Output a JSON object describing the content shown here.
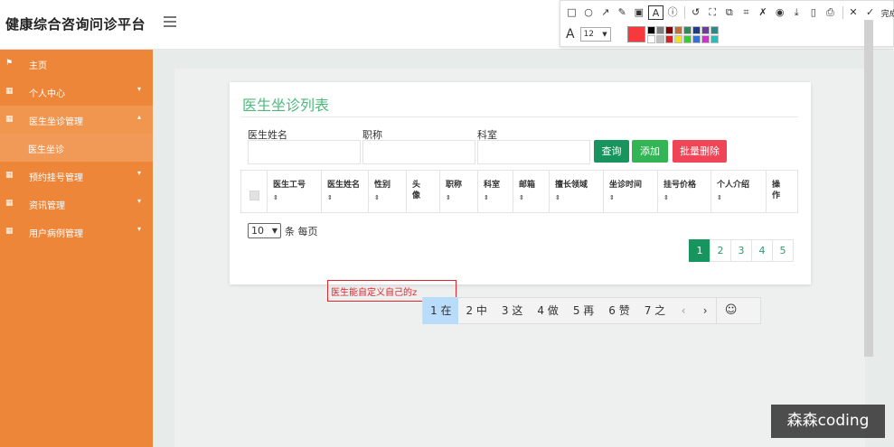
{
  "app": {
    "title": "健康综合咨询问诊平台"
  },
  "user": {
    "avatar_text": "头像"
  },
  "screenshot_tool": {
    "tools": [
      "□",
      "○",
      "↗",
      "✎",
      "▣",
      "A",
      "ⓘ",
      "↺",
      "⛶",
      "⧉",
      "⌗",
      "✗",
      "◉",
      "⤓",
      "▯",
      "⎙",
      "✕",
      "✓"
    ],
    "done_label": "完成",
    "font_size": "12",
    "current_color": "#f5393c",
    "palette": [
      "#000000",
      "#808080",
      "#800000",
      "#c07030",
      "#2e8b57",
      "#1e3a8a",
      "#6a3d9a",
      "#2a8a8a",
      "#ffffff",
      "#c0c0c0",
      "#e02020",
      "#f0e020",
      "#30d030",
      "#3070e0",
      "#d030d0",
      "#20c0c0"
    ]
  },
  "sidebar": {
    "items": [
      {
        "label": "主页",
        "icon": "flag-icon",
        "caret": ""
      },
      {
        "label": "个人中心",
        "icon": "grid-icon",
        "caret": "▾"
      },
      {
        "label": "医生坐诊管理",
        "icon": "grid-icon",
        "caret": "▴"
      },
      {
        "label": "医生坐诊",
        "icon": "",
        "caret": ""
      },
      {
        "label": "预约挂号管理",
        "icon": "grid-icon",
        "caret": "▾"
      },
      {
        "label": "资讯管理",
        "icon": "grid-icon",
        "caret": "▾"
      },
      {
        "label": "用户病例管理",
        "icon": "grid-icon",
        "caret": "▾"
      }
    ]
  },
  "page": {
    "title": "医生坐诊列表",
    "filters": {
      "doctor_name_label": "医生姓名",
      "title_label": "职称",
      "department_label": "科室"
    },
    "buttons": {
      "query": "查询",
      "add": "添加",
      "batch_delete": "批量删除"
    },
    "table": {
      "columns": [
        "医生工号",
        "医生姓名",
        "性别",
        "头像",
        "职称",
        "科室",
        "邮箱",
        "擅长领域",
        "坐诊时间",
        "挂号价格",
        "个人介绍",
        "操作"
      ],
      "sort_icon": "⇕"
    },
    "page_size": {
      "value": "10",
      "suffix": "条 每页"
    },
    "pagination": [
      "1",
      "2",
      "3",
      "4",
      "5"
    ],
    "active_page": "1"
  },
  "annotation": {
    "text": "医生能自定义自己的z"
  },
  "ime": {
    "candidates": [
      "1 在",
      "2 中",
      "3 这",
      "4 做",
      "5 再",
      "6 赞",
      "7 之"
    ],
    "prev": "‹",
    "next": "›",
    "emoji": "☺"
  },
  "watermark": "森森coding"
}
